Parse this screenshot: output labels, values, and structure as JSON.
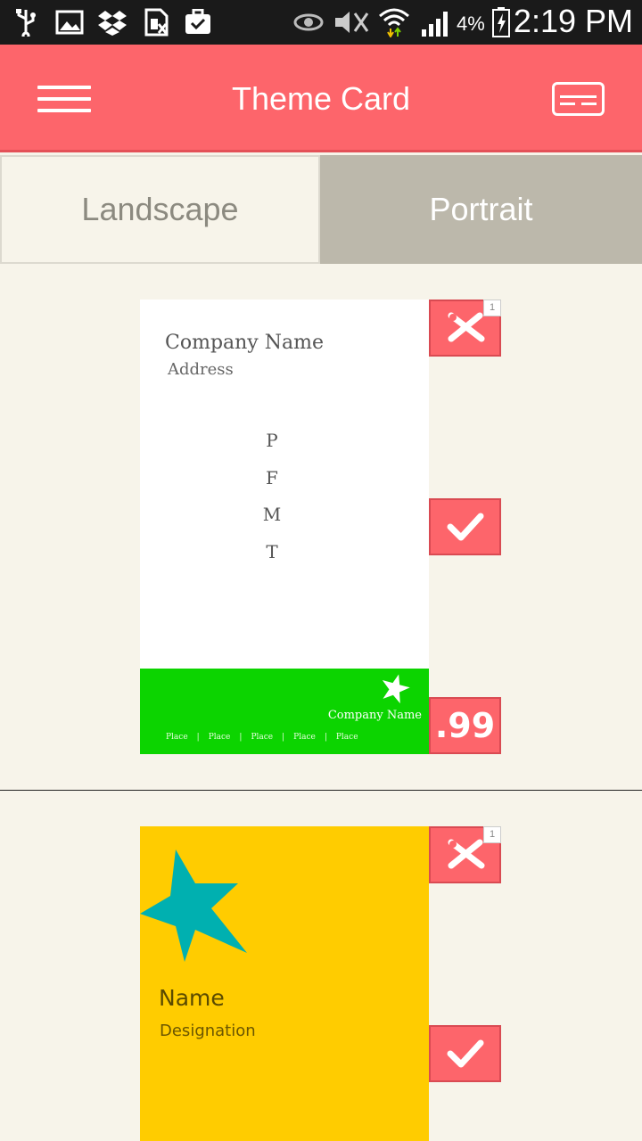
{
  "status_bar": {
    "battery_percent": "4%",
    "time": "2:19 PM",
    "icons": [
      "usb-icon",
      "image-icon",
      "dropbox-icon",
      "sim-icon",
      "briefcase-icon",
      "eye-icon",
      "mute-icon",
      "wifi-icon",
      "signal-icon",
      "battery-icon"
    ]
  },
  "app_bar": {
    "title": "Theme Card",
    "menu_icon": "hamburger-menu-icon",
    "action_icon": "card-icon"
  },
  "tabs": [
    {
      "label": "Landscape",
      "selected": false
    },
    {
      "label": "Portrait",
      "selected": true
    }
  ],
  "cards": [
    {
      "company_name": "Company Name",
      "address": "Address",
      "contact_letters": [
        "P",
        "F",
        "M",
        "T"
      ],
      "footer_company": "Company Name",
      "footer_places": [
        "Place",
        "|",
        "Place",
        "|",
        "Place",
        "|",
        "Place",
        "|",
        "Place"
      ],
      "badge": "1",
      "price": ".99",
      "colors": {
        "body": "#ffffff",
        "footer": "#0cd400"
      }
    },
    {
      "name": "Name",
      "designation": "Designation",
      "badge": "1",
      "colors": {
        "body": "#ffcc00",
        "star": "#00b0b0"
      }
    }
  ],
  "colors": {
    "accent": "#fd656b",
    "background": "#f7f4ea",
    "tab_selected": "#bcb8ab"
  }
}
